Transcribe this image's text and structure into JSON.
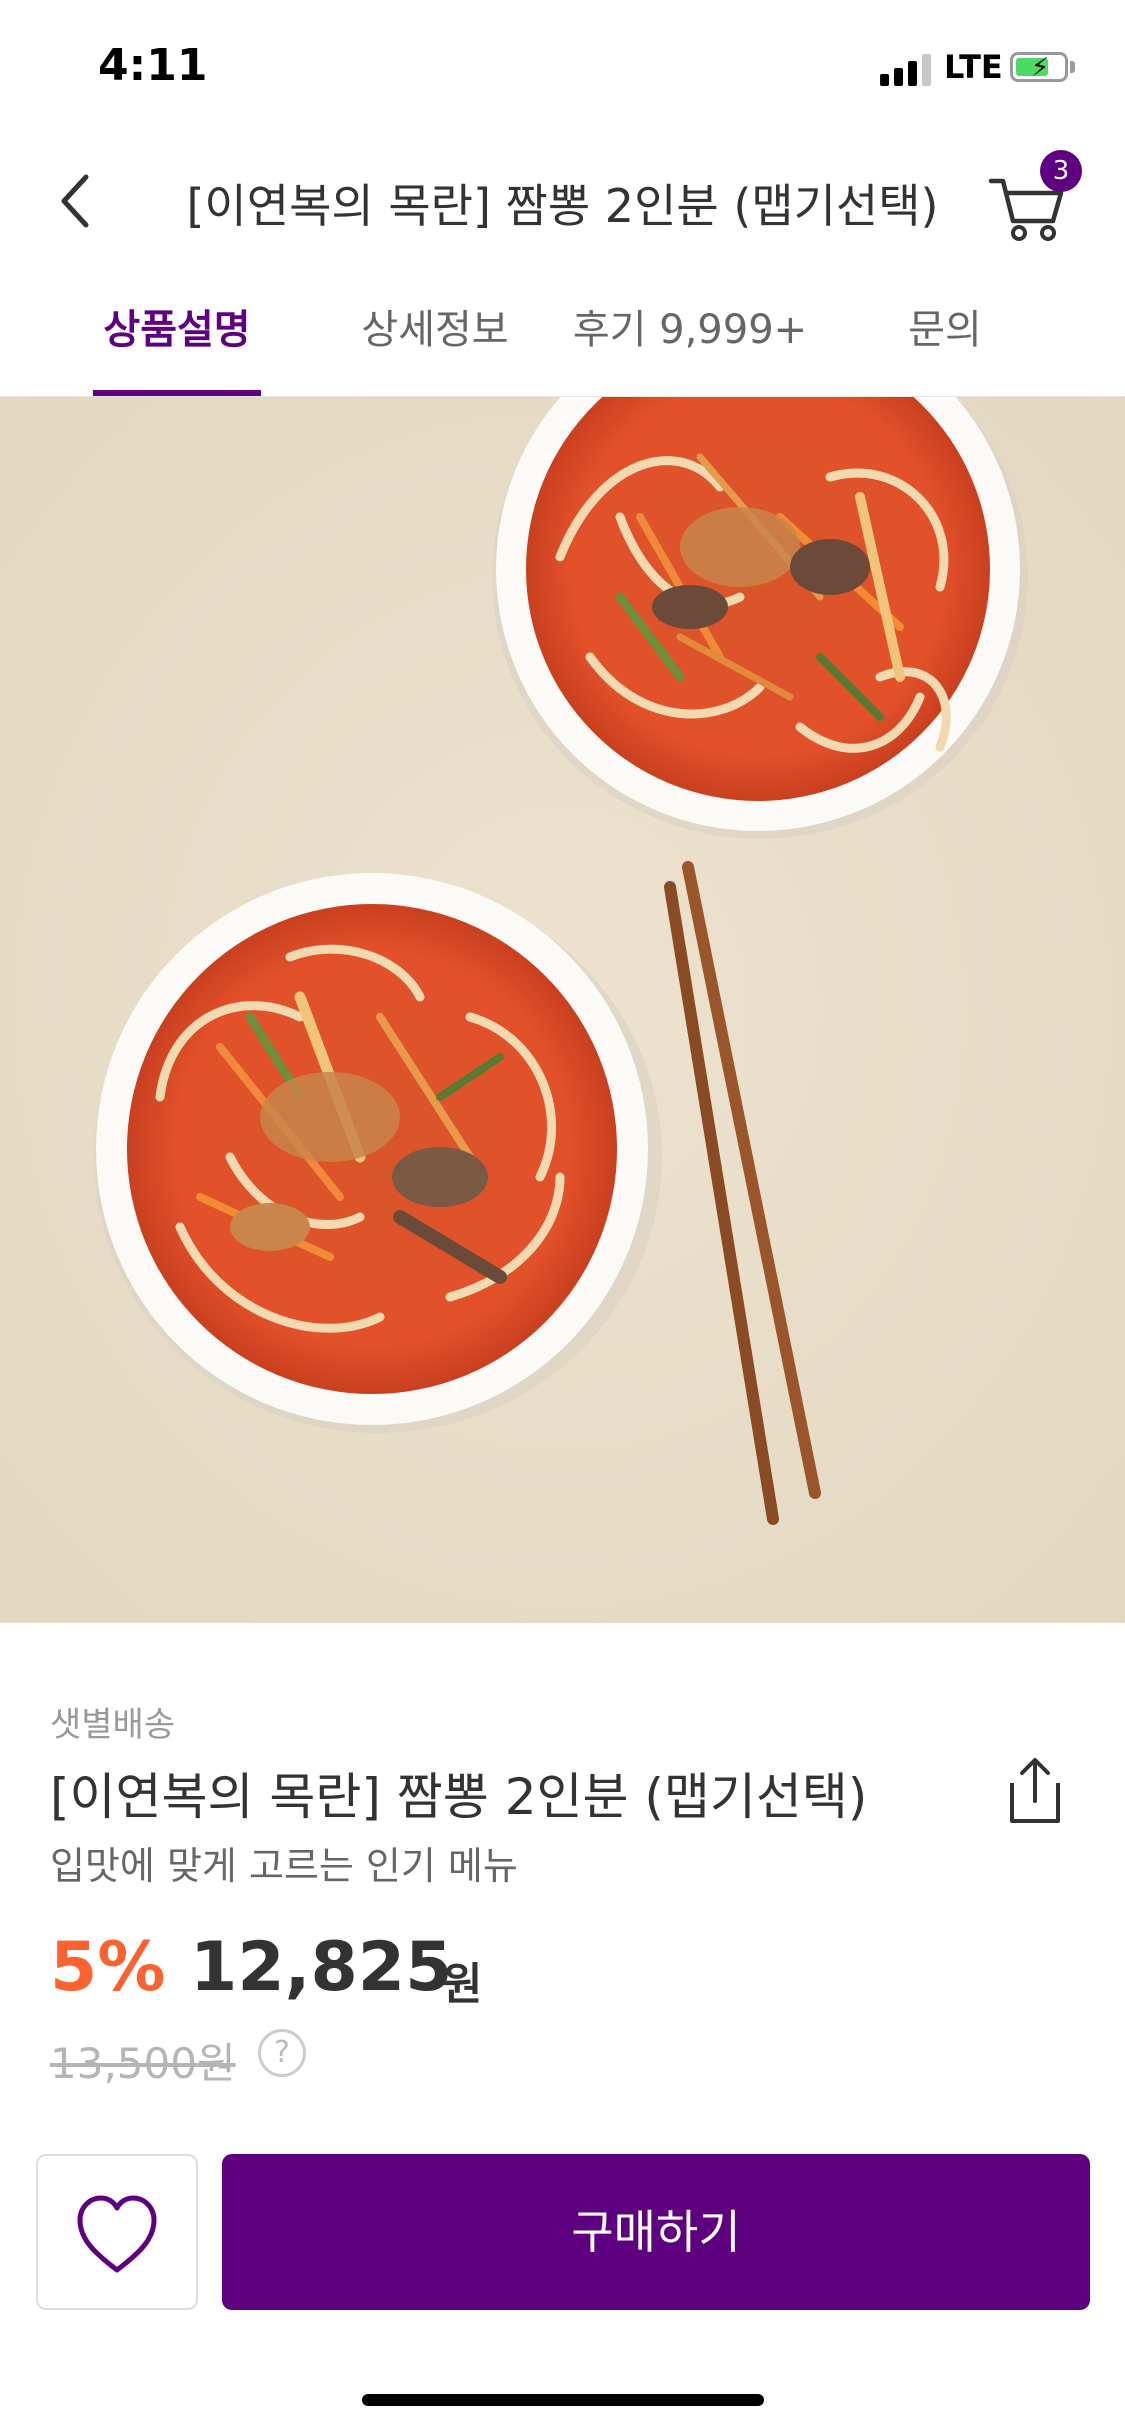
{
  "status": {
    "time": "4:11",
    "network": "LTE"
  },
  "nav": {
    "title": "[이연복의 목란] 짬뽕 2인분 (맵기선택)",
    "cart_count": "3"
  },
  "tabs": [
    {
      "label": "상품설명",
      "active": true
    },
    {
      "label": "상세정보",
      "active": false
    },
    {
      "label": "후기 9,999+",
      "active": false
    },
    {
      "label": "문의",
      "active": false
    }
  ],
  "product": {
    "delivery": "샛별배송",
    "name": "[이연복의 목란] 짬뽕 2인분 (맵기선택)",
    "subtitle": "입맛에 맞게 고르는 인기 메뉴",
    "discount": "5%",
    "price": "12,825",
    "unit": "원",
    "original_price": "13,500원"
  },
  "actions": {
    "buy_label": "구매하기"
  },
  "icons": {
    "back": "chevron-left-icon",
    "cart": "cart-icon",
    "share": "share-icon",
    "help": "question-circle-icon",
    "wish": "heart-outline-icon"
  },
  "colors": {
    "brand": "#5f0080",
    "discount": "#fa622f",
    "battery": "#4cd964"
  }
}
